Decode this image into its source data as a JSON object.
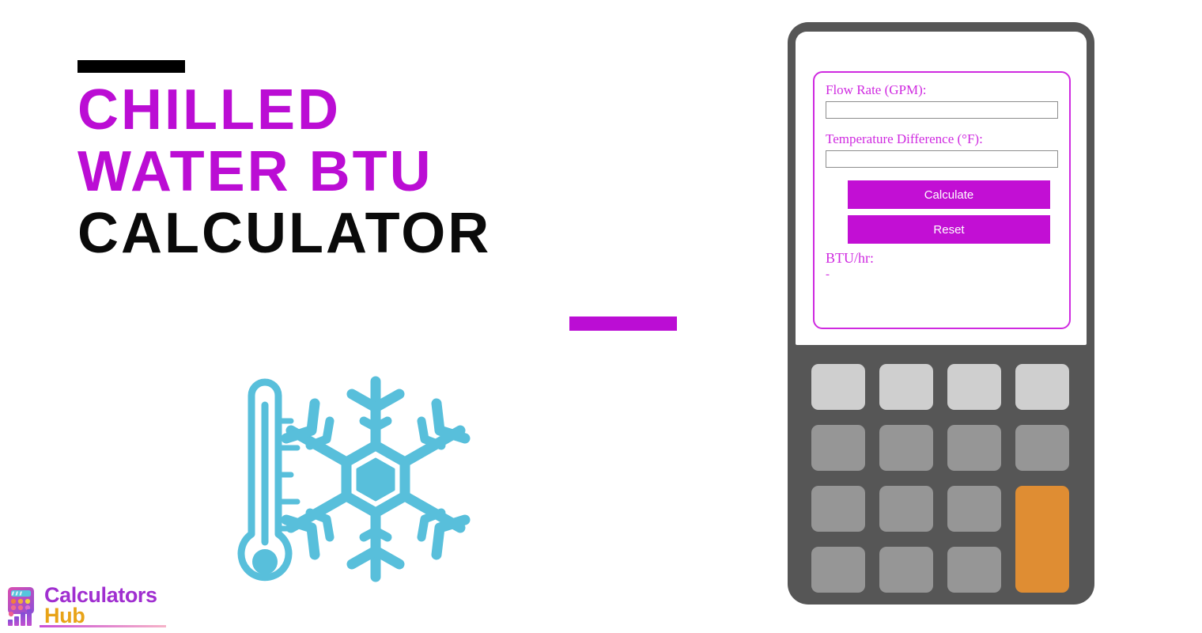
{
  "hero": {
    "title_lines": [
      {
        "text": "Chilled",
        "color": "#bb0dd4"
      },
      {
        "text": "Water BTU",
        "color": "#bb0dd4"
      },
      {
        "text": "Calculator",
        "color": "#0a0a0a"
      }
    ],
    "rule_top_color": "#000000",
    "rule_bottom_color": "#bb0dd4",
    "artwork": {
      "icon_name": "thermometer-snowflake-icon",
      "color": "#58bfdb"
    }
  },
  "brand": {
    "name_part_1": "Calculators",
    "name_part_2": "Hub",
    "color_part_1": "#a02fd0",
    "color_part_2": "#e8a317",
    "mark_name": "calculator-bar-chart-logo-icon"
  },
  "calculator": {
    "device_color": "#565656",
    "accent_color": "#c20fd4",
    "form": {
      "fields": [
        {
          "label": "Flow Rate (GPM):",
          "value": "",
          "placeholder": ""
        },
        {
          "label": "Temperature Difference (°F):",
          "value": "",
          "placeholder": ""
        }
      ],
      "buttons": [
        {
          "label": "Calculate"
        },
        {
          "label": "Reset"
        }
      ],
      "result_label": "BTU/hr:",
      "result_value": "-"
    },
    "keypad": {
      "rows": 4,
      "columns": 4,
      "top_row_color": "#cfcfcf",
      "key_color": "#969696",
      "accent_key_color": "#df8d33"
    }
  }
}
